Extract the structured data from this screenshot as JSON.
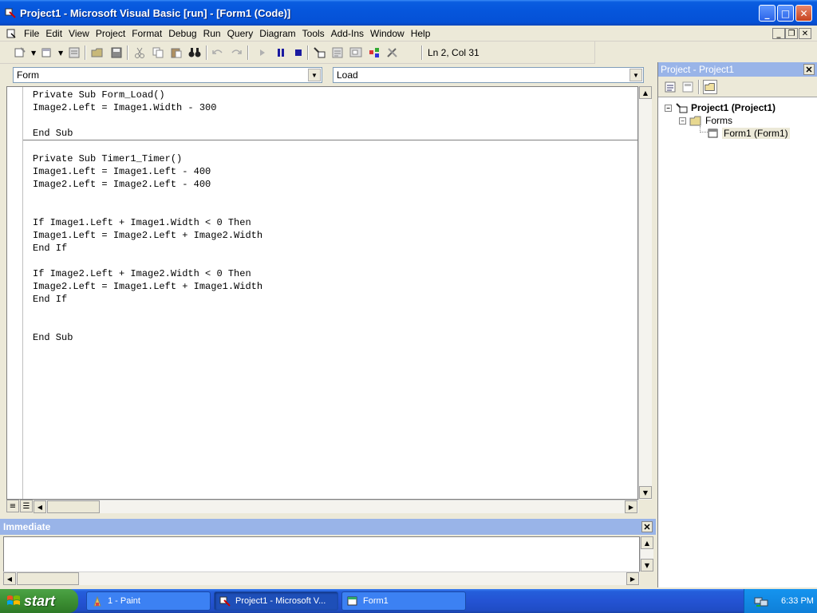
{
  "window": {
    "title": "Project1 - Microsoft Visual Basic [run] - [Form1 (Code)]",
    "min_glyph": "_",
    "max_glyph": "□",
    "close_glyph": "✕"
  },
  "menubar": {
    "items": [
      "File",
      "Edit",
      "View",
      "Project",
      "Format",
      "Debug",
      "Run",
      "Query",
      "Diagram",
      "Tools",
      "Add-Ins",
      "Window",
      "Help"
    ]
  },
  "toolbar": {
    "status": "Ln 2, Col 31"
  },
  "code_window": {
    "object_combo": "Form",
    "procedure_combo": "Load",
    "lines": [
      "Private Sub Form_Load()",
      "Image2.Left = Image1.Width - 300",
      "",
      "End Sub",
      "",
      "Private Sub Timer1_Timer()",
      "Image1.Left = Image1.Left - 400",
      "Image2.Left = Image2.Left - 400",
      "",
      "",
      "If Image1.Left + Image1.Width < 0 Then",
      "Image1.Left = Image2.Left + Image2.Width",
      "End If",
      "",
      "If Image2.Left + Image2.Width < 0 Then",
      "Image2.Left = Image1.Left + Image1.Width",
      "End If",
      "",
      "",
      "End Sub"
    ]
  },
  "project_panel": {
    "title": "Project - Project1",
    "tree": {
      "project": "Project1 (Project1)",
      "folder": "Forms",
      "form": "Form1 (Form1)"
    }
  },
  "immediate": {
    "title": "Immediate"
  },
  "taskbar": {
    "start_label": "start",
    "buttons": [
      {
        "label": "1 - Paint"
      },
      {
        "label": "Project1 - Microsoft V..."
      },
      {
        "label": "Form1"
      }
    ],
    "clock": "6:33 PM"
  },
  "colors": {
    "title_blue": "#0656dc",
    "panel_header": "#99b4e8",
    "start_green": "#3c8f33"
  }
}
